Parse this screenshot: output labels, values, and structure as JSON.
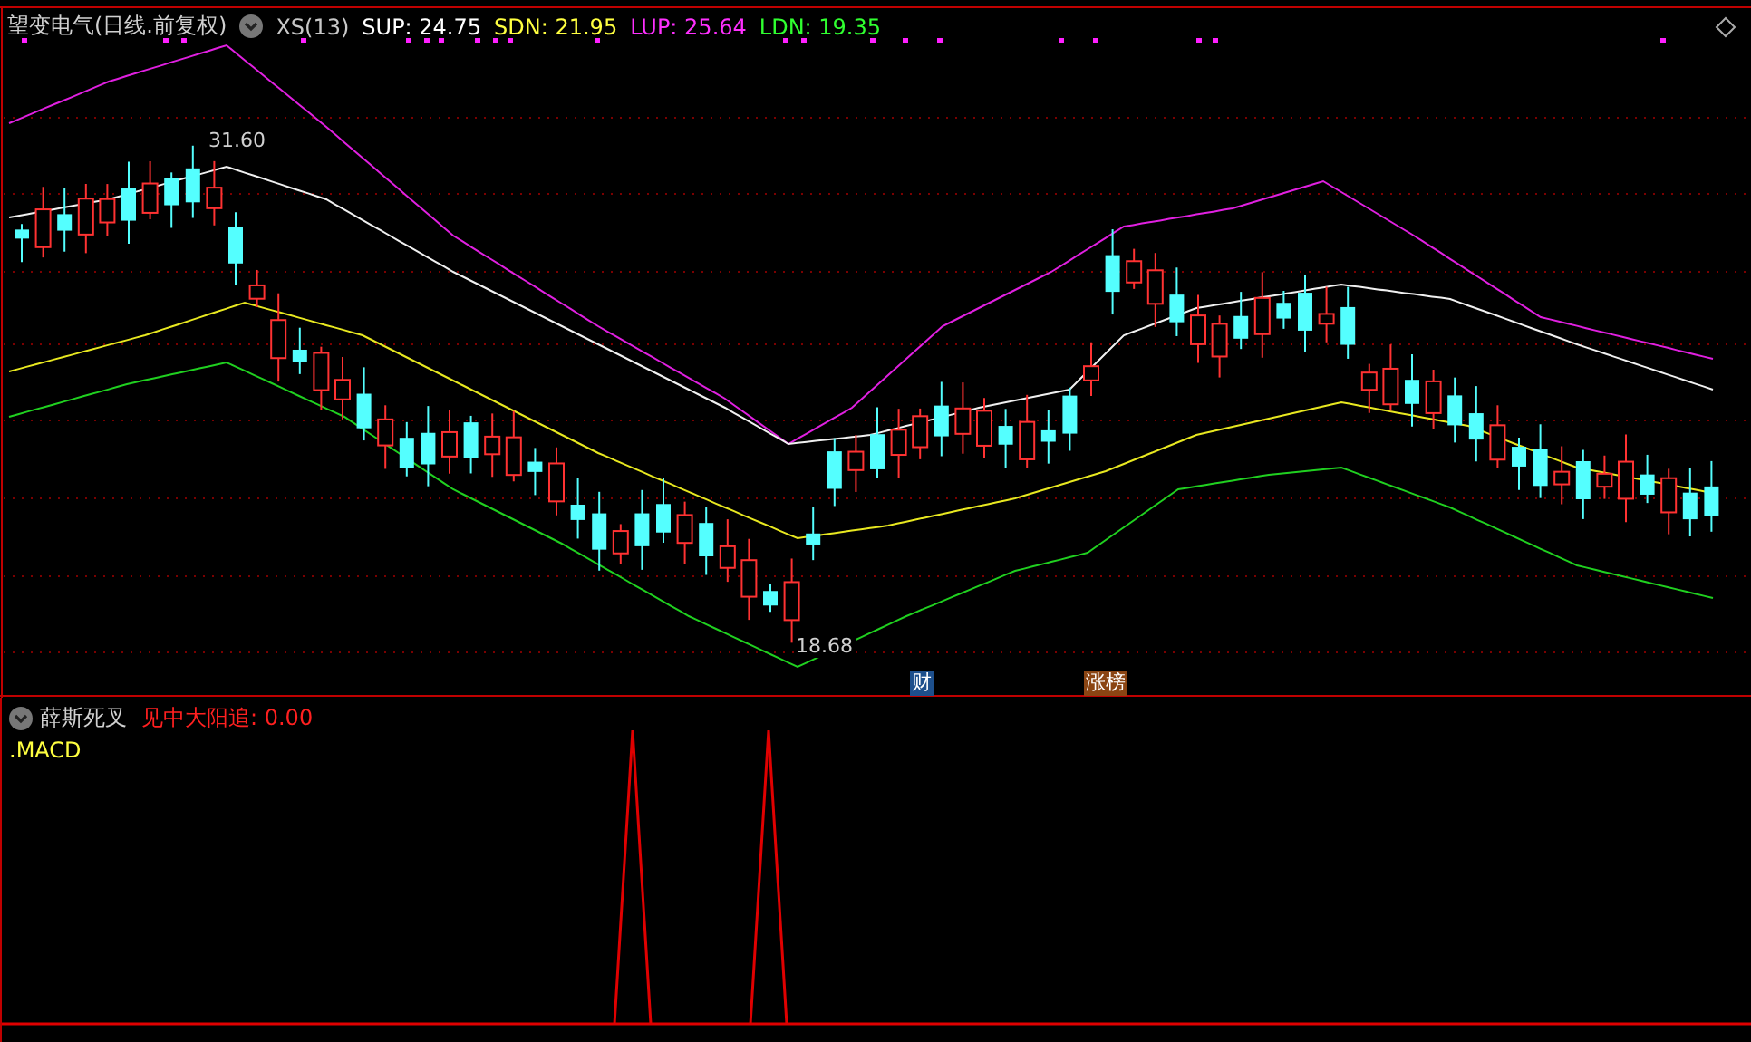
{
  "main_pane": {
    "title": "望变电气(日线.前复权)",
    "indicators": [
      {
        "label": "XS(13)",
        "color": "#c8c8c8"
      },
      {
        "label": "SUP: 24.75",
        "color": "#ffffff"
      },
      {
        "label": "SDN: 21.95",
        "color": "#ffff40"
      },
      {
        "label": "LUP: 25.64",
        "color": "#ff30ff"
      },
      {
        "label": "LDN: 19.35",
        "color": "#30ff30"
      }
    ],
    "annotations": [
      {
        "text": "31.60"
      },
      {
        "text": "18.68"
      }
    ],
    "badges": [
      {
        "text": "财",
        "color": "#1d4f8c"
      },
      {
        "text": "涨榜",
        "color": "#8b4513"
      }
    ]
  },
  "sub_pane": {
    "title": "薛斯死叉",
    "signal": "见中大阳追: 0.00",
    "label": ".MACD"
  }
}
